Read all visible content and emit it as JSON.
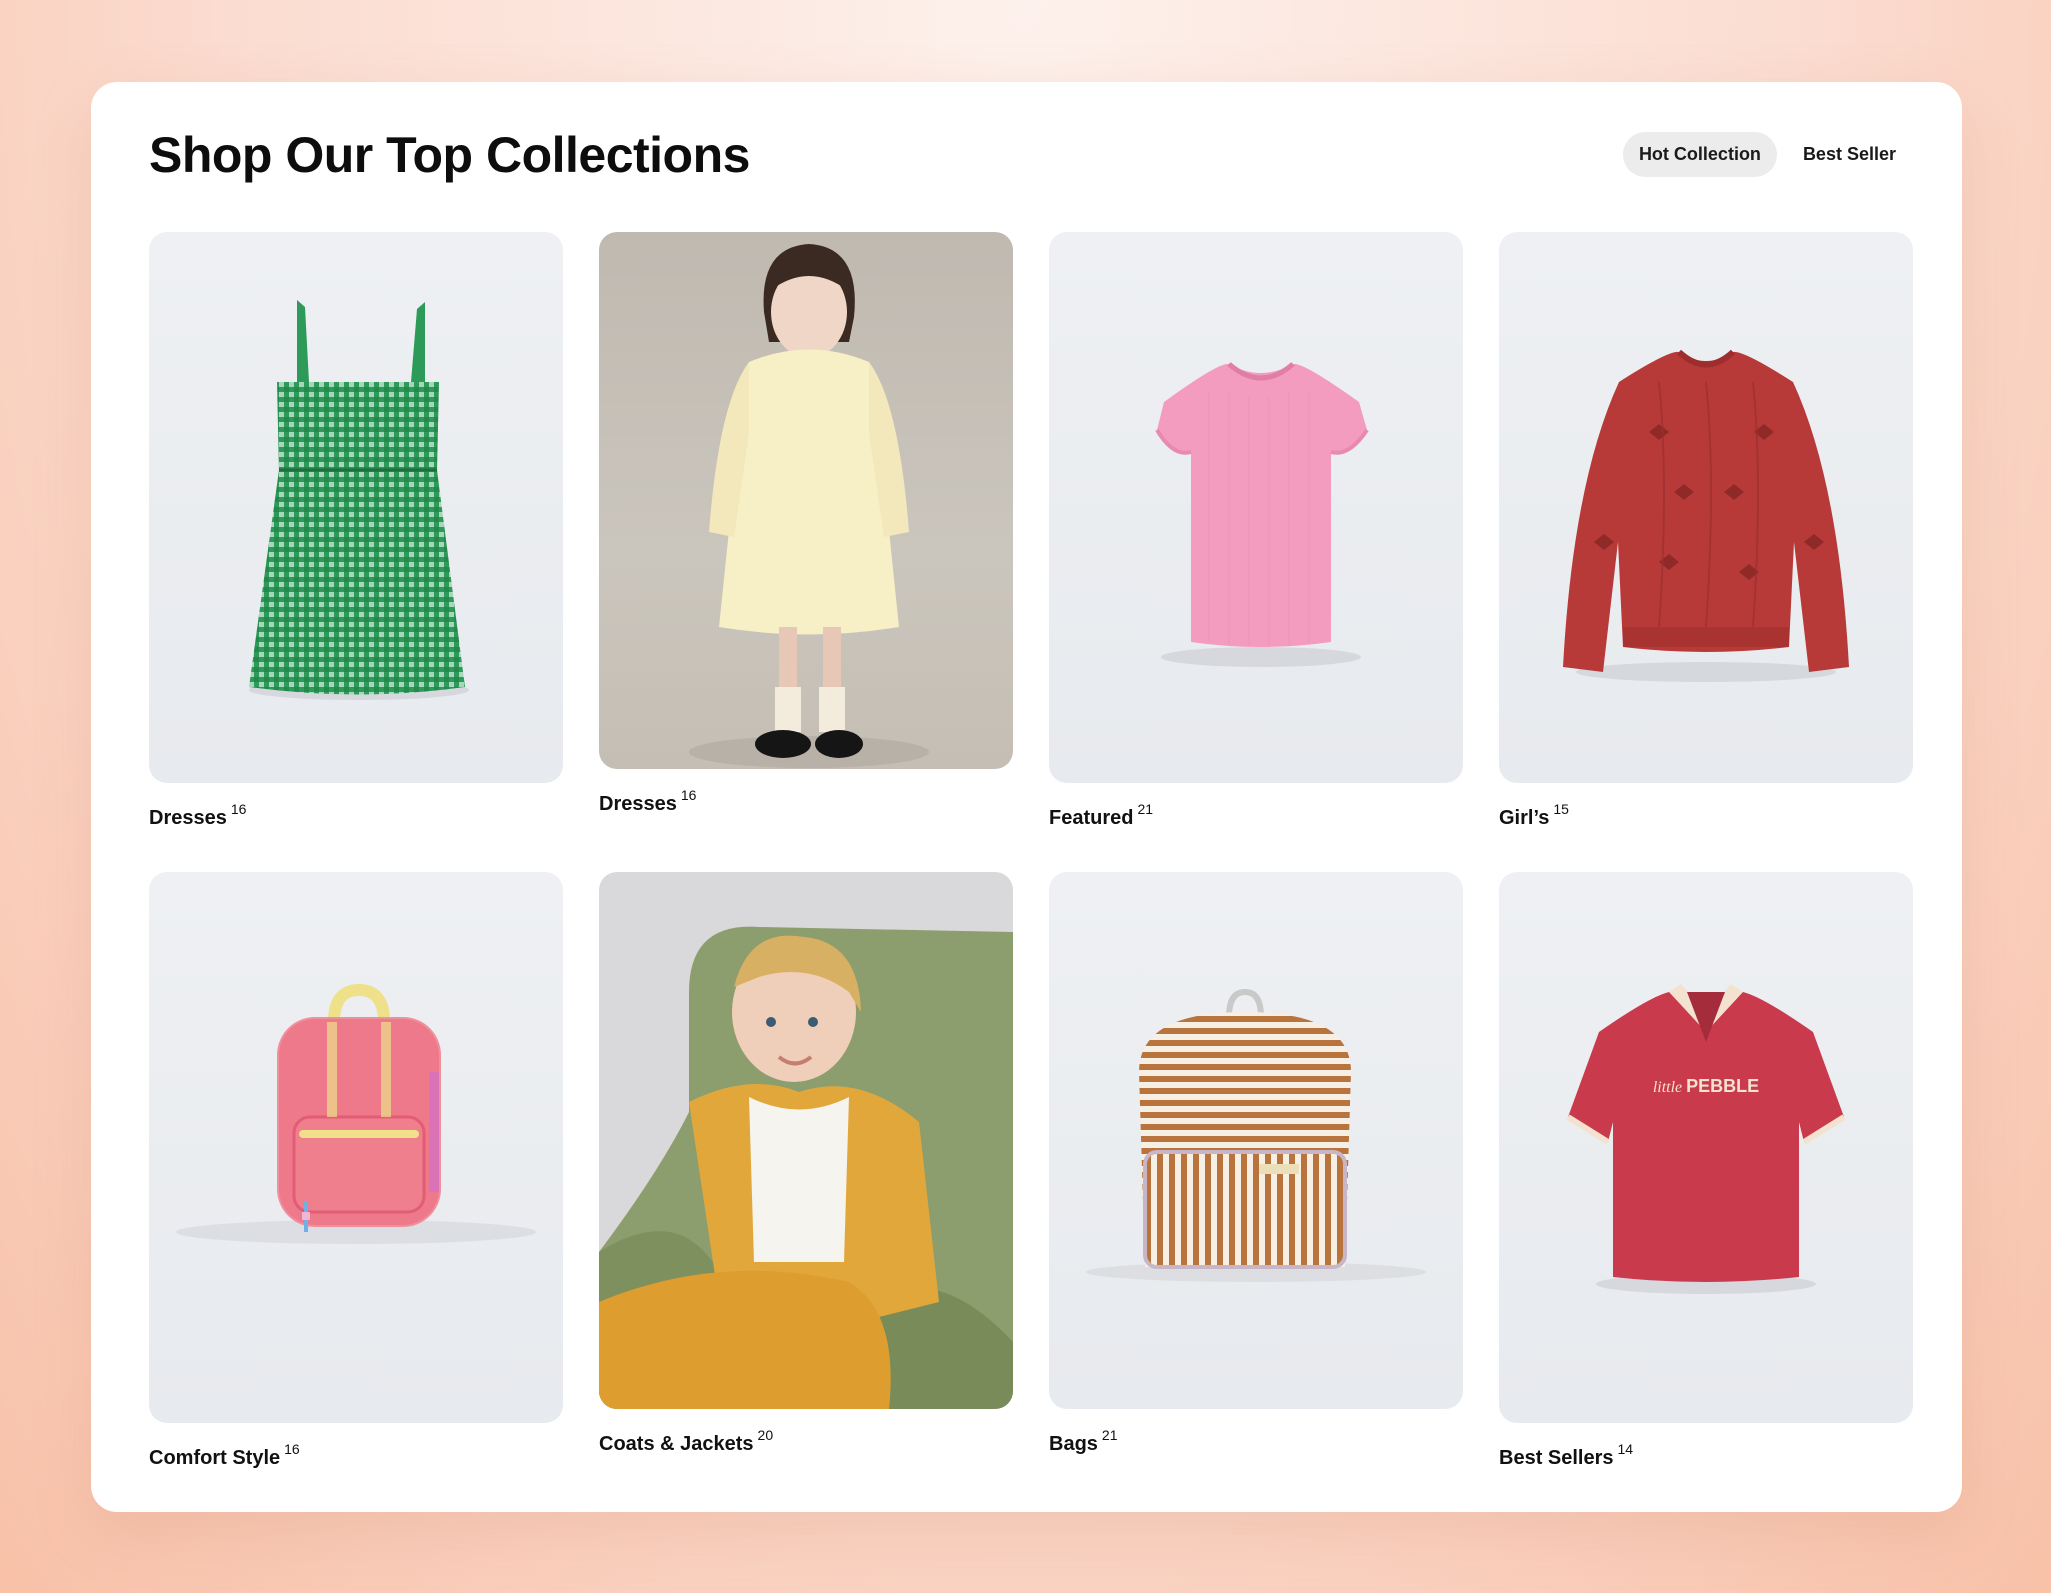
{
  "header": {
    "title": "Shop Our Top Collections",
    "tabs": [
      {
        "label": "Hot Collection",
        "active": true
      },
      {
        "label": "Best Seller",
        "active": false
      }
    ]
  },
  "collections": [
    {
      "name": "Dresses",
      "count": "16",
      "icon": "green-dress-image"
    },
    {
      "name": "Dresses",
      "count": "16",
      "icon": "girl-in-dress-photo"
    },
    {
      "name": "Featured",
      "count": "21",
      "icon": "pink-tshirt-image"
    },
    {
      "name": "Girl’s",
      "count": "15",
      "icon": "red-sweater-image"
    },
    {
      "name": "Comfort Style",
      "count": "16",
      "icon": "pink-backpack-image"
    },
    {
      "name": "Coats & Jackets",
      "count": "20",
      "icon": "boy-in-jacket-photo"
    },
    {
      "name": "Bags",
      "count": "21",
      "icon": "striped-backpack-image"
    },
    {
      "name": "Best Sellers",
      "count": "14",
      "icon": "red-polo-image"
    }
  ],
  "products": {
    "polo_print_script": "little",
    "polo_print_bold": "PEBBLE"
  },
  "colors": {
    "background": "#f8c1a8",
    "panel": "#ffffff",
    "active_tab": "#ececec"
  }
}
